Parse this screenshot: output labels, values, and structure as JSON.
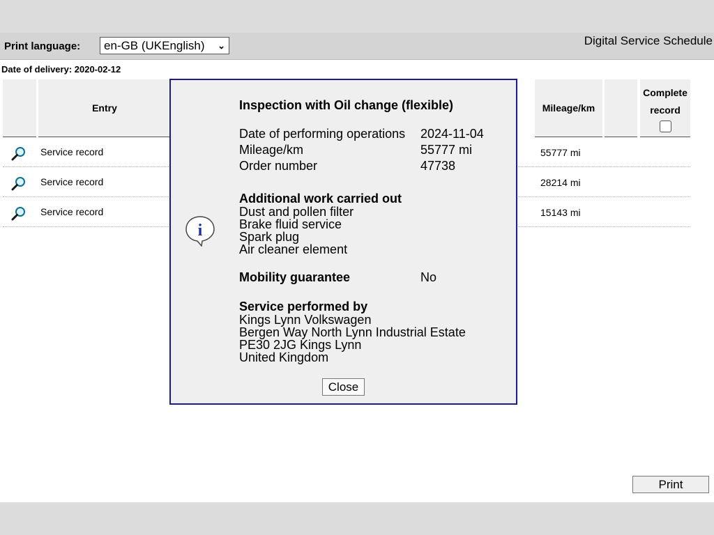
{
  "header": {
    "print_language_label": "Print language:",
    "print_language_value": "en-GB (UKEnglish)",
    "app_title": "Digital Service Schedule"
  },
  "delivery_date": "Date of delivery: 2020-02-12",
  "table": {
    "columns": {
      "entry": "Entry",
      "mileage": "Mileage/km",
      "complete_line1": "Complete",
      "complete_line2": "record"
    },
    "rows": [
      {
        "entry": "Service record",
        "mileage": "55777 mi"
      },
      {
        "entry": "Service record",
        "mileage": "28214 mi"
      },
      {
        "entry": "Service record",
        "mileage": "15143 mi"
      }
    ]
  },
  "dialog": {
    "icon": "info-icon",
    "title": "Inspection with Oil change (flexible)",
    "fields": [
      {
        "label": "Date of performing operations",
        "value": "2024-11-04"
      },
      {
        "label": "Mileage/km",
        "value": "55777 mi"
      },
      {
        "label": "Order number",
        "value": "47738"
      }
    ],
    "additional_work_title": "Additional work carried out",
    "additional_work": [
      "Dust and pollen filter",
      "Brake fluid service",
      "Spark plug",
      "Air cleaner element"
    ],
    "mobility_label": "Mobility guarantee",
    "mobility_value": "No",
    "service_by_title": "Service performed by",
    "service_by": [
      "Kings Lynn Volkswagen",
      "Bergen Way North Lynn Industrial Estate",
      "PE30 2JG Kings Lynn",
      "United Kingdom"
    ],
    "close_label": "Close"
  },
  "print_label": "Print",
  "colors": {
    "dialog_border": "#1c1c8e",
    "header_bg": "#d4d4d4"
  }
}
